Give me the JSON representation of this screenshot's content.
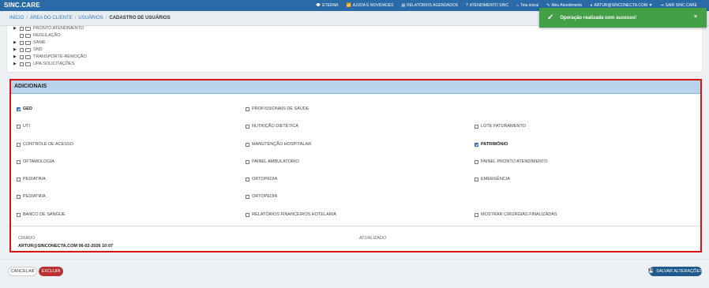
{
  "topbar": {
    "brand": "SINC.CARE",
    "nav": [
      "ETERNA",
      "AJUDA E NOVIDADES",
      "RELATÓRIOS AGENDADOS",
      "ATENDIMENTO SINC",
      "Tela inicial",
      "Meu Atendimento",
      "ARTUR@SINCONECTA.COM ▼",
      "SAIR SINC.CARE"
    ]
  },
  "breadcrumb": {
    "items": [
      "INÍCIO",
      "ÁREA DO CLIENTE",
      "USUÁRIOS"
    ],
    "current": "CADASTRO DE USUÁRIOS"
  },
  "toast": {
    "message": "Operação realizada com sucesso!",
    "close": "×"
  },
  "tree": [
    {
      "label": "PRONTO ATENDIMENTO",
      "expandable": true
    },
    {
      "label": "REGULAÇÃO",
      "expandable": false
    },
    {
      "label": "SAME",
      "expandable": true
    },
    {
      "label": "SND",
      "expandable": true
    },
    {
      "label": "TRANSPORTE-REMOÇÃO",
      "expandable": true
    },
    {
      "label": "UPA SOLICITAÇÕES",
      "expandable": true
    }
  ],
  "adicionais": {
    "title": "ADICIONAIS",
    "col1": [
      {
        "label": "GED",
        "checked": true
      },
      {
        "label": "UTI",
        "checked": false
      },
      {
        "label": "CONTROLE DE ACESSO",
        "checked": false
      },
      {
        "label": "OFTAMOLOGIA",
        "checked": false
      },
      {
        "label": "PEDIATRIA",
        "checked": false
      },
      {
        "label": "PEDIATRIA",
        "checked": false
      },
      {
        "label": "BANCO DE SANGUE",
        "checked": false
      }
    ],
    "col2": [
      {
        "label": "PROFISSIONAIS DE SAÚDE",
        "checked": false
      },
      {
        "label": "NUTRIÇÃO DIETÉTICA",
        "checked": false
      },
      {
        "label": "MANUTENÇÃO HOSPITALAR",
        "checked": false
      },
      {
        "label": "PAINEL AMBULATORIO",
        "checked": false
      },
      {
        "label": "ORTOPEDIA",
        "checked": false
      },
      {
        "label": "ORTOPEDIA",
        "checked": false
      },
      {
        "label": "RELATÓRIOS FINANCEIROS HOTELARIA",
        "checked": false
      }
    ],
    "col3": [
      {
        "label": "LOTE FATURAMENTO",
        "checked": false
      },
      {
        "label": "PATRIMÔNIO",
        "checked": true
      },
      {
        "label": "PAINEL PRONTO ATENDIMENTO",
        "checked": false
      },
      {
        "label": "EMERGÊNCIA",
        "checked": false
      },
      {
        "label": "MOSTRAR CIRURGIAS FINALIZADAS",
        "checked": false
      }
    ],
    "criado_label": "CRIADO",
    "criado_value": "ARTUR@SINCONECTA.COM 06-02-2026 10:07",
    "atualizado_label": "ATUALIZADO"
  },
  "actions": {
    "cancel": "CANCELAR",
    "delete": "EXCLUIR",
    "save": "SALVAR ALTERAÇÕES"
  },
  "colors": {
    "topbar": "#2a6aa6",
    "toast": "#43a047",
    "highlight_border": "#dd1111",
    "delete": "#b83232",
    "save": "#1f5a8c"
  }
}
